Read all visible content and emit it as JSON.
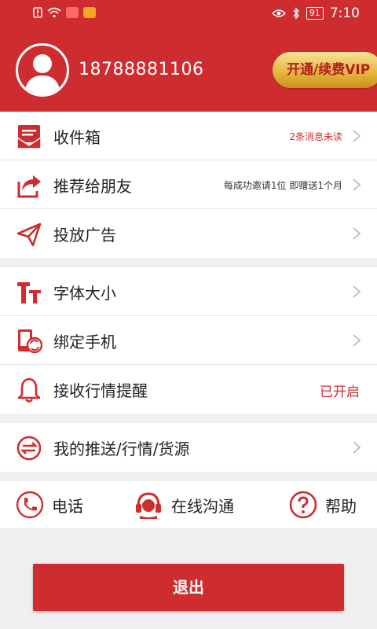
{
  "status_bar": {
    "battery": "91",
    "time": "7:10"
  },
  "profile": {
    "phone": "18788881106",
    "vip_button": "开通/续费VIP"
  },
  "group1": [
    {
      "icon": "inbox-icon",
      "label": "收件箱",
      "hint": "2条消息未读"
    },
    {
      "icon": "share-icon",
      "label": "推荐给朋友",
      "hint": "每成功邀请1位 即赠送1个月"
    },
    {
      "icon": "paper-plane-icon",
      "label": "投放广告"
    }
  ],
  "group2": [
    {
      "icon": "font-size-icon",
      "label": "字体大小"
    },
    {
      "icon": "phone-bind-icon",
      "label": "绑定手机"
    },
    {
      "icon": "bell-icon",
      "label": "接收行情提醒",
      "status": "已开启"
    }
  ],
  "group3": [
    {
      "icon": "exchange-icon",
      "label": "我的推送/行情/货源"
    }
  ],
  "bottom_bar": {
    "phone": "电话",
    "chat": "在线沟通",
    "help": "帮助"
  },
  "logout": "退出",
  "colors": {
    "primary": "#cf2c2f",
    "gold": "#e8b83c"
  }
}
